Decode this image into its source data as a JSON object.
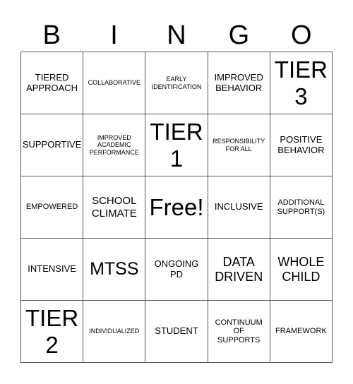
{
  "header": {
    "letters": [
      "B",
      "I",
      "N",
      "G",
      "O"
    ]
  },
  "card": {
    "rows": [
      [
        "TIERED\nAPPROACH",
        "COLLABORATIVE",
        "EARLY\nIDENTIFICATION",
        "IMPROVED\nBEHAVIOR",
        "TIER\n3"
      ],
      [
        "SUPPORTIVE",
        "IMPROVED\nACADEMIC\nPERFORMANCE",
        "TIER\n1",
        "RESPONSIBILITY\nFOR ALL",
        "POSITIVE\nBEHAVIOR"
      ],
      [
        "EMPOWERED",
        "SCHOOL\nCLIMATE",
        "Free!",
        "INCLUSIVE",
        "ADDITIONAL\nSUPPORT(S)"
      ],
      [
        "INTENSIVE",
        "MTSS",
        "ONGOING\nPD",
        "DATA\nDRIVEN",
        "WHOLE\nCHILD"
      ],
      [
        "TIER\n2",
        "INDIVIDUALIZED",
        "STUDENT",
        "CONTINUUM\nOF\nSUPPORTS",
        "FRAMEWORK"
      ]
    ]
  }
}
